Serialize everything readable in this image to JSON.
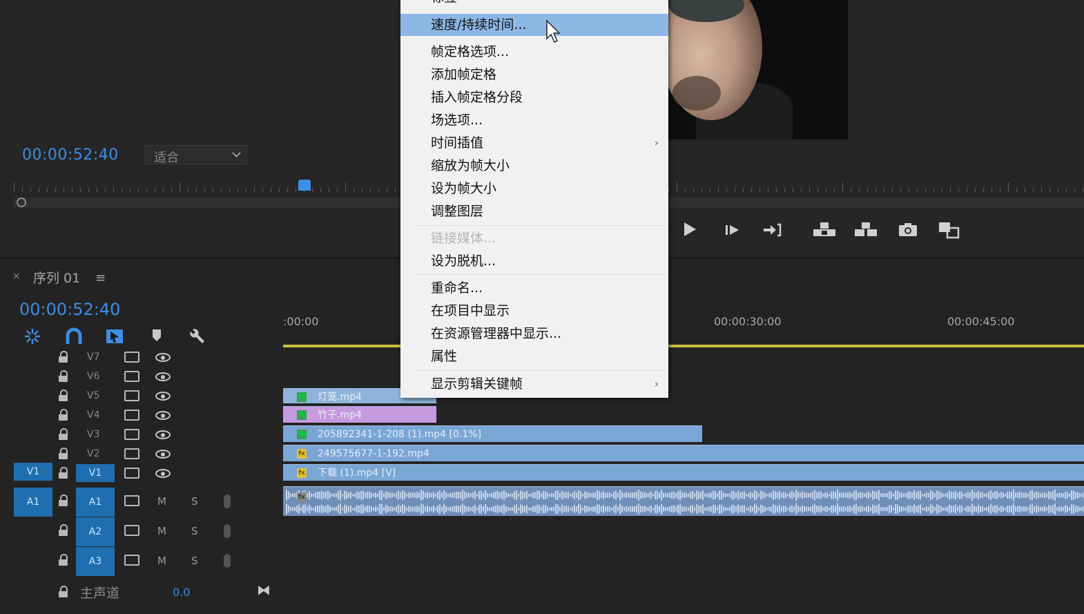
{
  "program_monitor": {
    "timecode": "00:00:52:40",
    "zoom_value": "适合"
  },
  "sequence": {
    "close": "×",
    "tab_title": "序列 01",
    "menu": "≡",
    "timecode": "00:00:52:40"
  },
  "ruler": {
    "labels": [
      ":00:00",
      "00:00:30:00",
      "00:00:45:00"
    ]
  },
  "tracks": {
    "video": [
      "V7",
      "V6",
      "V5",
      "V4",
      "V3",
      "V2",
      "V1"
    ],
    "audio": [
      "A1",
      "A2",
      "A3"
    ],
    "v1_source": "V1",
    "a1_source": "A1",
    "audio_m": "M",
    "audio_s": "S",
    "master_label": "主声道",
    "master_value": "0.0"
  },
  "clips": {
    "v5": "灯笼.mp4",
    "v4": "竹子.mp4",
    "v3": "205892341-1-208 (1).mp4 [0.1%]",
    "v2": "249575677-1-192.mp4",
    "v1": "下载 (1).mp4 [V]",
    "fx": "fx"
  },
  "context_menu": {
    "top_item": "标签",
    "items": [
      "速度/持续时间...",
      "帧定格选项...",
      "添加帧定格",
      "插入帧定格分段",
      "场选项...",
      "时间插值",
      "缩放为帧大小",
      "设为帧大小",
      "调整图层",
      "链接媒体...",
      "设为脱机...",
      "重命名...",
      "在项目中显示",
      "在资源管理器中显示...",
      "属性",
      "显示剪辑关键帧"
    ]
  },
  "icons": [
    "play-icon",
    "step-forward-icon",
    "go-to-out-icon",
    "lift-icon",
    "extract-icon",
    "camera-icon",
    "compare-icon",
    "snap-icon",
    "magnet-icon",
    "linked-selection-icon",
    "marker-icon",
    "wrench-icon",
    "lock-icon",
    "film-icon",
    "eye-icon",
    "mic-icon"
  ],
  "colors": {
    "accent": "#3d8ee6",
    "menu_selected": "#8db8e6",
    "clip_blue": "#7aa6d6",
    "clip_purple": "#c79ae0",
    "work_bar": "#c8c23a",
    "target": "#1f6fb0"
  }
}
